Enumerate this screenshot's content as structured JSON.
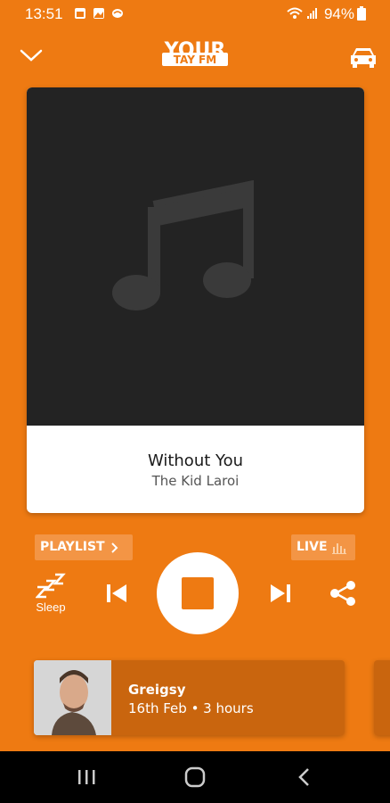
{
  "status_bar": {
    "time": "13:51",
    "battery": "94%"
  },
  "header": {
    "logo_text": "YOUR TAY FM"
  },
  "track": {
    "title": "Without You",
    "artist": "The Kid Laroi"
  },
  "playlist_label": "PLAYLIST",
  "live_label": "LIVE",
  "controls": {
    "sleep_label": "Sleep"
  },
  "presenter": {
    "name": "Greigsy",
    "meta": "16th Feb • 3 hours"
  },
  "colors": {
    "brand": "#ee7a12",
    "card_dark": "#232323",
    "presenter_bg": "#c9650e"
  },
  "icons": [
    "chevron-down-icon",
    "car-icon",
    "music-note-icon",
    "chevron-right-icon",
    "equalizer-icon",
    "sleep-icon",
    "skip-previous-icon",
    "stop-icon",
    "skip-next-icon",
    "share-icon",
    "recents-icon",
    "home-icon",
    "back-icon"
  ]
}
